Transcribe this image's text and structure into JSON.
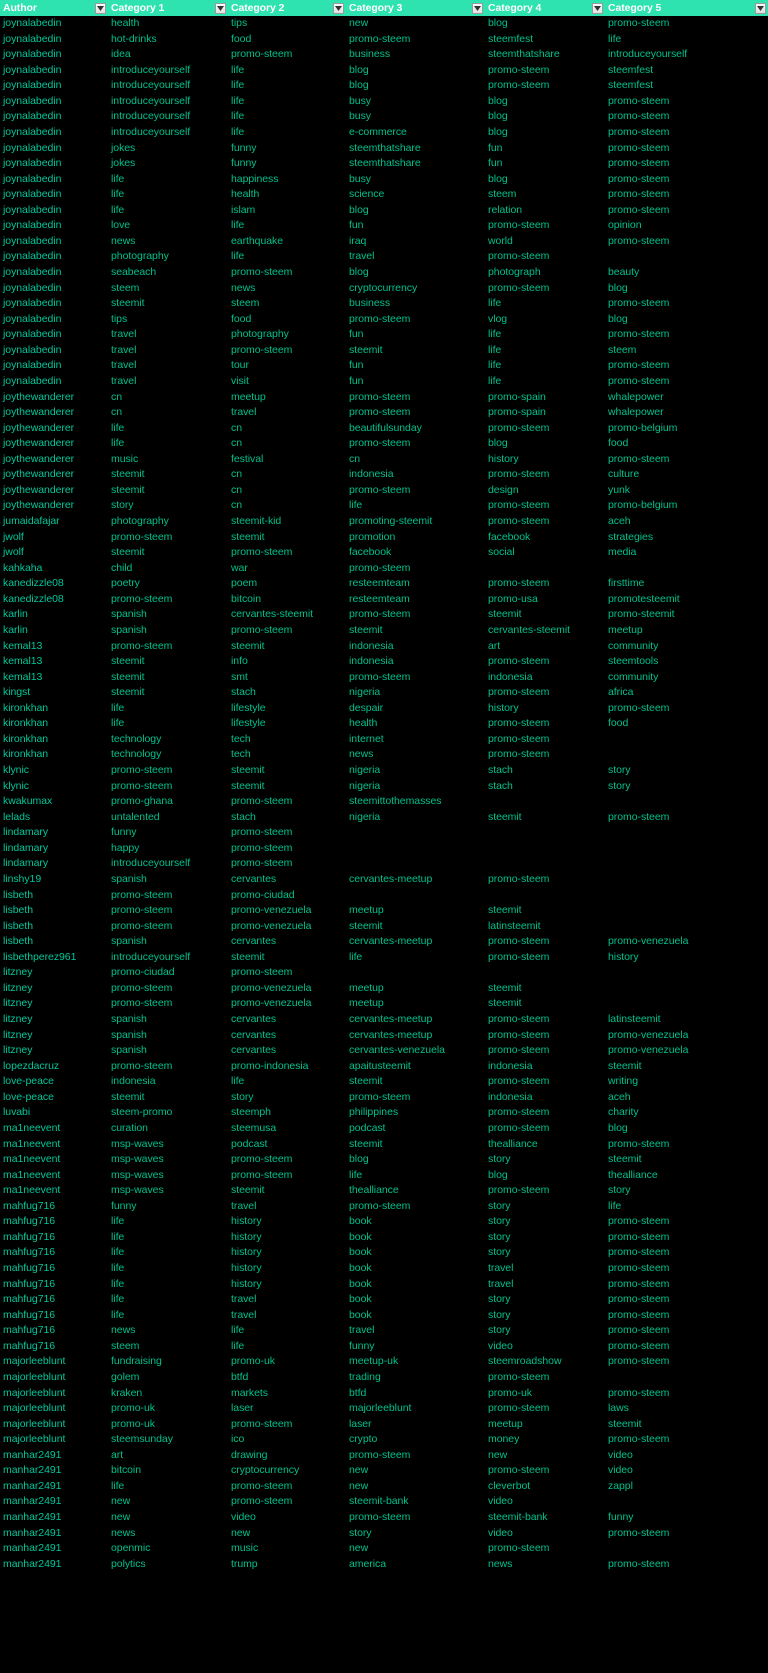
{
  "table": {
    "columns": [
      {
        "label": "Author",
        "key": "author",
        "filter_icon": "chevron-down-icon"
      },
      {
        "label": "Category 1",
        "key": "cat1",
        "filter_icon": "chevron-down-icon"
      },
      {
        "label": "Category 2",
        "key": "cat2",
        "filter_icon": "chevron-down-icon"
      },
      {
        "label": "Category 3",
        "key": "cat3",
        "filter_icon": "chevron-down-icon"
      },
      {
        "label": "Category 4",
        "key": "cat4",
        "filter_icon": "chevron-down-icon"
      },
      {
        "label": "Category 5",
        "key": "cat5",
        "filter_icon": "chevron-down-icon"
      }
    ],
    "colors": {
      "header_background": "#2ee3b0",
      "header_text": "#ffffff",
      "body_background": "#000000",
      "body_text": "#00c08a",
      "filter_button_face": "#e8e8e8",
      "filter_button_border": "#9a9a9a"
    },
    "rows": [
      [
        "joynalabedin",
        "health",
        "tips",
        "new",
        "blog",
        "promo-steem"
      ],
      [
        "joynalabedin",
        "hot-drinks",
        "food",
        "promo-steem",
        "steemfest",
        "life"
      ],
      [
        "joynalabedin",
        "idea",
        "promo-steem",
        "business",
        "steemthatshare",
        "introduceyourself"
      ],
      [
        "joynalabedin",
        "introduceyourself",
        "life",
        "blog",
        "promo-steem",
        "steemfest"
      ],
      [
        "joynalabedin",
        "introduceyourself",
        "life",
        "blog",
        "promo-steem",
        "steemfest"
      ],
      [
        "joynalabedin",
        "introduceyourself",
        "life",
        "busy",
        "blog",
        "promo-steem"
      ],
      [
        "joynalabedin",
        "introduceyourself",
        "life",
        "busy",
        "blog",
        "promo-steem"
      ],
      [
        "joynalabedin",
        "introduceyourself",
        "life",
        "e-commerce",
        "blog",
        "promo-steem"
      ],
      [
        "joynalabedin",
        "jokes",
        "funny",
        "steemthatshare",
        "fun",
        "promo-steem"
      ],
      [
        "joynalabedin",
        "jokes",
        "funny",
        "steemthatshare",
        "fun",
        "promo-steem"
      ],
      [
        "joynalabedin",
        "life",
        "happiness",
        "busy",
        "blog",
        "promo-steem"
      ],
      [
        "joynalabedin",
        "life",
        "health",
        "science",
        "steem",
        "promo-steem"
      ],
      [
        "joynalabedin",
        "life",
        "islam",
        "blog",
        "relation",
        "promo-steem"
      ],
      [
        "joynalabedin",
        "love",
        "life",
        "fun",
        "promo-steem",
        "opinion"
      ],
      [
        "joynalabedin",
        "news",
        "earthquake",
        "iraq",
        "world",
        "promo-steem"
      ],
      [
        "joynalabedin",
        "photography",
        "life",
        "travel",
        "promo-steem",
        ""
      ],
      [
        "joynalabedin",
        "seabeach",
        "promo-steem",
        "blog",
        "photograph",
        "beauty"
      ],
      [
        "joynalabedin",
        "steem",
        "news",
        "cryptocurrency",
        "promo-steem",
        "blog"
      ],
      [
        "joynalabedin",
        "steemit",
        "steem",
        "business",
        "life",
        "promo-steem"
      ],
      [
        "joynalabedin",
        "tips",
        "food",
        "promo-steem",
        "vlog",
        "blog"
      ],
      [
        "joynalabedin",
        "travel",
        "photography",
        "fun",
        "life",
        "promo-steem"
      ],
      [
        "joynalabedin",
        "travel",
        "promo-steem",
        "steemit",
        "life",
        "steem"
      ],
      [
        "joynalabedin",
        "travel",
        "tour",
        "fun",
        "life",
        "promo-steem"
      ],
      [
        "joynalabedin",
        "travel",
        "visit",
        "fun",
        "life",
        "promo-steem"
      ],
      [
        "joythewanderer",
        "cn",
        "meetup",
        "promo-steem",
        "promo-spain",
        "whalepower"
      ],
      [
        "joythewanderer",
        "cn",
        "travel",
        "promo-steem",
        "promo-spain",
        "whalepower"
      ],
      [
        "joythewanderer",
        "life",
        "cn",
        "beautifulsunday",
        "promo-steem",
        "promo-belgium"
      ],
      [
        "joythewanderer",
        "life",
        "cn",
        "promo-steem",
        "blog",
        "food"
      ],
      [
        "joythewanderer",
        "music",
        "festival",
        "cn",
        "history",
        "promo-steem"
      ],
      [
        "joythewanderer",
        "steemit",
        "cn",
        "indonesia",
        "promo-steem",
        "culture"
      ],
      [
        "joythewanderer",
        "steemit",
        "cn",
        "promo-steem",
        "design",
        "yunk"
      ],
      [
        "joythewanderer",
        "story",
        "cn",
        "life",
        "promo-steem",
        "promo-belgium"
      ],
      [
        "jumaidafajar",
        "photography",
        "steemit-kid",
        "promoting-steemit",
        "promo-steem",
        "aceh"
      ],
      [
        "jwolf",
        "promo-steem",
        "steemit",
        "promotion",
        "facebook",
        "strategies"
      ],
      [
        "jwolf",
        "steemit",
        "promo-steem",
        "facebook",
        "social",
        "media"
      ],
      [
        "kahkaha",
        "child",
        "war",
        "promo-steem",
        "",
        ""
      ],
      [
        "kanedizzle08",
        "poetry",
        "poem",
        "resteemteam",
        "promo-steem",
        "firsttime"
      ],
      [
        "kanedizzle08",
        "promo-steem",
        "bitcoin",
        "resteemteam",
        "promo-usa",
        "promotesteemit"
      ],
      [
        "karlin",
        "spanish",
        "cervantes-steemit",
        "promo-steem",
        "steemit",
        "promo-steemit"
      ],
      [
        "karlin",
        "spanish",
        "promo-steem",
        "steemit",
        "cervantes-steemit",
        "meetup"
      ],
      [
        "kemal13",
        "promo-steem",
        "steemit",
        "indonesia",
        "art",
        "community"
      ],
      [
        "kemal13",
        "steemit",
        "info",
        "indonesia",
        "promo-steem",
        "steemtools"
      ],
      [
        "kemal13",
        "steemit",
        "smt",
        "promo-steem",
        "indonesia",
        "community"
      ],
      [
        "kingst",
        "steemit",
        "stach",
        "nigeria",
        "promo-steem",
        "africa"
      ],
      [
        "kironkhan",
        "life",
        "lifestyle",
        "despair",
        "history",
        "promo-steem"
      ],
      [
        "kironkhan",
        "life",
        "lifestyle",
        "health",
        "promo-steem",
        "food"
      ],
      [
        "kironkhan",
        "technology",
        "tech",
        "internet",
        "promo-steem",
        ""
      ],
      [
        "kironkhan",
        "technology",
        "tech",
        "news",
        "promo-steem",
        ""
      ],
      [
        "klynic",
        "promo-steem",
        "steemit",
        "nigeria",
        "stach",
        "story"
      ],
      [
        "klynic",
        "promo-steem",
        "steemit",
        "nigeria",
        "stach",
        "story"
      ],
      [
        "kwakumax",
        "promo-ghana",
        "promo-steem",
        "steemittothemasses",
        "",
        ""
      ],
      [
        "lelads",
        "untalented",
        "stach",
        "nigeria",
        "steemit",
        "promo-steem"
      ],
      [
        "lindamary",
        "funny",
        "promo-steem",
        "",
        "",
        ""
      ],
      [
        "lindamary",
        "happy",
        "promo-steem",
        "",
        "",
        ""
      ],
      [
        "lindamary",
        "introduceyourself",
        "promo-steem",
        "",
        "",
        ""
      ],
      [
        "linshy19",
        "spanish",
        "cervantes",
        "cervantes-meetup",
        "promo-steem",
        ""
      ],
      [
        "lisbeth",
        "promo-steem",
        "promo-ciudad",
        "",
        "",
        ""
      ],
      [
        "lisbeth",
        "promo-steem",
        "promo-venezuela",
        "meetup",
        "steemit",
        ""
      ],
      [
        "lisbeth",
        "promo-steem",
        "promo-venezuela",
        "steemit",
        "latinsteemit",
        ""
      ],
      [
        "lisbeth",
        "spanish",
        "cervantes",
        "cervantes-meetup",
        "promo-steem",
        "promo-venezuela"
      ],
      [
        "lisbethperez961",
        "introduceyourself",
        "steemit",
        "life",
        "promo-steem",
        "history"
      ],
      [
        "litzney",
        "promo-ciudad",
        "promo-steem",
        "",
        "",
        ""
      ],
      [
        "litzney",
        "promo-steem",
        "promo-venezuela",
        "meetup",
        "steemit",
        ""
      ],
      [
        "litzney",
        "promo-steem",
        "promo-venezuela",
        "meetup",
        "steemit",
        ""
      ],
      [
        "litzney",
        "spanish",
        "cervantes",
        "cervantes-meetup",
        "promo-steem",
        "latinsteemit"
      ],
      [
        "litzney",
        "spanish",
        "cervantes",
        "cervantes-meetup",
        "promo-steem",
        "promo-venezuela"
      ],
      [
        "litzney",
        "spanish",
        "cervantes",
        "cervantes-venezuela",
        "promo-steem",
        "promo-venezuela"
      ],
      [
        "lopezdacruz",
        "promo-steem",
        "promo-indonesia",
        "apaitusteemit",
        "indonesia",
        "steemit"
      ],
      [
        "love-peace",
        "indonesia",
        "life",
        "steemit",
        "promo-steem",
        "writing"
      ],
      [
        "love-peace",
        "steemit",
        "story",
        "promo-steem",
        "indonesia",
        "aceh"
      ],
      [
        "luvabi",
        "steem-promo",
        "steemph",
        "philippines",
        "promo-steem",
        "charity"
      ],
      [
        "ma1neevent",
        "curation",
        "steemusa",
        "podcast",
        "promo-steem",
        "blog"
      ],
      [
        "ma1neevent",
        "msp-waves",
        "podcast",
        "steemit",
        "thealliance",
        "promo-steem"
      ],
      [
        "ma1neevent",
        "msp-waves",
        "promo-steem",
        "blog",
        "story",
        "steemit"
      ],
      [
        "ma1neevent",
        "msp-waves",
        "promo-steem",
        "life",
        "blog",
        "thealliance"
      ],
      [
        "ma1neevent",
        "msp-waves",
        "steemit",
        "thealliance",
        "promo-steem",
        "story"
      ],
      [
        "mahfug716",
        "funny",
        "travel",
        "promo-steem",
        "story",
        "life"
      ],
      [
        "mahfug716",
        "life",
        "history",
        "book",
        "story",
        "promo-steem"
      ],
      [
        "mahfug716",
        "life",
        "history",
        "book",
        "story",
        "promo-steem"
      ],
      [
        "mahfug716",
        "life",
        "history",
        "book",
        "story",
        "promo-steem"
      ],
      [
        "mahfug716",
        "life",
        "history",
        "book",
        "travel",
        "promo-steem"
      ],
      [
        "mahfug716",
        "life",
        "history",
        "book",
        "travel",
        "promo-steem"
      ],
      [
        "mahfug716",
        "life",
        "travel",
        "book",
        "story",
        "promo-steem"
      ],
      [
        "mahfug716",
        "life",
        "travel",
        "book",
        "story",
        "promo-steem"
      ],
      [
        "mahfug716",
        "news",
        "life",
        "travel",
        "story",
        "promo-steem"
      ],
      [
        "mahfug716",
        "steem",
        "life",
        "funny",
        "video",
        "promo-steem"
      ],
      [
        "majorleeblunt",
        "fundraising",
        "promo-uk",
        "meetup-uk",
        "steemroadshow",
        "promo-steem"
      ],
      [
        "majorleeblunt",
        "golem",
        "btfd",
        "trading",
        "promo-steem",
        ""
      ],
      [
        "majorleeblunt",
        "kraken",
        "markets",
        "btfd",
        "promo-uk",
        "promo-steem"
      ],
      [
        "majorleeblunt",
        "promo-uk",
        "laser",
        "majorleeblunt",
        "promo-steem",
        "laws"
      ],
      [
        "majorleeblunt",
        "promo-uk",
        "promo-steem",
        "laser",
        "meetup",
        "steemit"
      ],
      [
        "majorleeblunt",
        "steemsunday",
        "ico",
        "crypto",
        "money",
        "promo-steem"
      ],
      [
        "manhar2491",
        "art",
        "drawing",
        "promo-steem",
        "new",
        "video"
      ],
      [
        "manhar2491",
        "bitcoin",
        "cryptocurrency",
        "new",
        "promo-steem",
        "video"
      ],
      [
        "manhar2491",
        "life",
        "promo-steem",
        "new",
        "cleverbot",
        "zappl"
      ],
      [
        "manhar2491",
        "new",
        "promo-steem",
        "steemit-bank",
        "video",
        ""
      ],
      [
        "manhar2491",
        "new",
        "video",
        "promo-steem",
        "steemit-bank",
        "funny"
      ],
      [
        "manhar2491",
        "news",
        "new",
        "story",
        "video",
        "promo-steem"
      ],
      [
        "manhar2491",
        "openmic",
        "music",
        "new",
        "promo-steem",
        ""
      ],
      [
        "manhar2491",
        "polytics",
        "trump",
        "america",
        "news",
        "promo-steem"
      ]
    ]
  }
}
